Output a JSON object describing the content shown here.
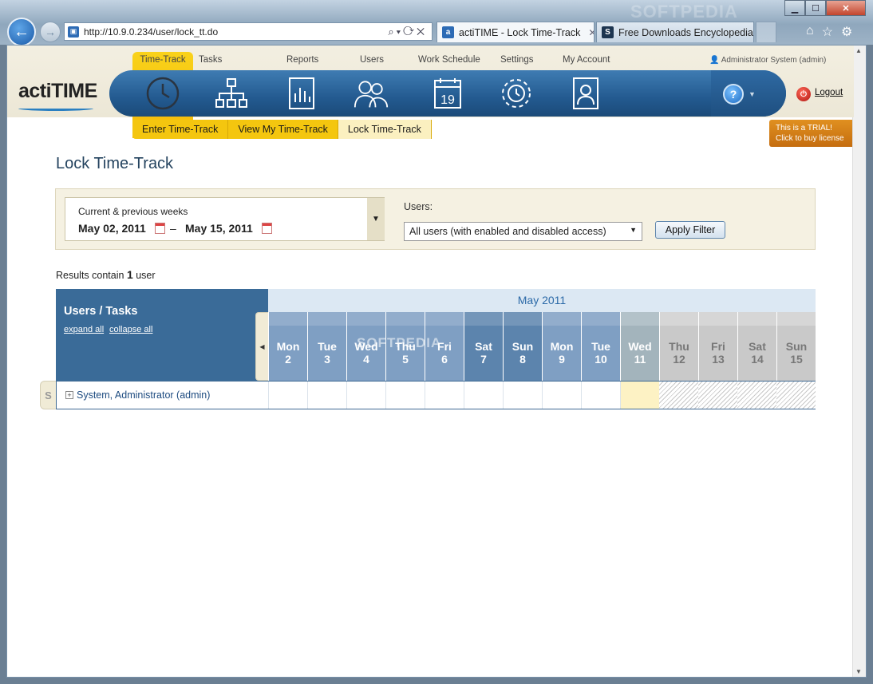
{
  "browser": {
    "watermark": "SOFTPEDIA",
    "url": "http://10.9.0.234/user/lock_tt.do",
    "tabs": [
      {
        "title": "actiTIME - Lock Time-Track",
        "active": true
      },
      {
        "title": "Free Downloads Encyclopedia ...",
        "active": false
      }
    ]
  },
  "app": {
    "logo": "actiTIME",
    "user": "Administrator System (admin)",
    "logout": "Logout",
    "help_icon": "question-mark",
    "trial": {
      "line1": "This is a TRIAL!",
      "line2": "Click to buy license"
    },
    "modules": [
      {
        "label": "Time-Track",
        "icon": "clock",
        "active": true
      },
      {
        "label": "Tasks",
        "icon": "org-chart"
      },
      {
        "label": "Reports",
        "icon": "bar-chart-document"
      },
      {
        "label": "Users",
        "icon": "people"
      },
      {
        "label": "Work Schedule",
        "icon": "calendar-19"
      },
      {
        "label": "Settings",
        "icon": "gear"
      },
      {
        "label": "My Account",
        "icon": "profile-card"
      }
    ],
    "subnav": [
      {
        "label": "Enter Time-Track"
      },
      {
        "label": "View My Time-Track"
      },
      {
        "label": "Lock Time-Track",
        "active": true
      }
    ]
  },
  "page": {
    "title": "Lock Time-Track",
    "filter": {
      "range_label": "Current & previous weeks",
      "from": "May 02, 2011",
      "dash": "–",
      "to": "May 15, 2011",
      "users_label": "Users:",
      "users_value": "All users (with enabled and disabled access)",
      "apply": "Apply Filter"
    },
    "results": {
      "prefix": "Results contain",
      "count": "1",
      "suffix": "user"
    },
    "grid": {
      "header": "Users / Tasks",
      "expand_all": "expand all",
      "collapse_all": "collapse all",
      "month": "May 2011",
      "days": [
        {
          "dow": "Mon",
          "num": "2",
          "state": "open"
        },
        {
          "dow": "Tue",
          "num": "3",
          "state": "open"
        },
        {
          "dow": "Wed",
          "num": "4",
          "state": "open"
        },
        {
          "dow": "Thu",
          "num": "5",
          "state": "open"
        },
        {
          "dow": "Fri",
          "num": "6",
          "state": "open"
        },
        {
          "dow": "Sat",
          "num": "7",
          "state": "weekend"
        },
        {
          "dow": "Sun",
          "num": "8",
          "state": "weekend"
        },
        {
          "dow": "Mon",
          "num": "9",
          "state": "open"
        },
        {
          "dow": "Tue",
          "num": "10",
          "state": "open"
        },
        {
          "dow": "Wed",
          "num": "11",
          "state": "today"
        },
        {
          "dow": "Thu",
          "num": "12",
          "state": "future"
        },
        {
          "dow": "Fri",
          "num": "13",
          "state": "future"
        },
        {
          "dow": "Sat",
          "num": "14",
          "state": "future"
        },
        {
          "dow": "Sun",
          "num": "15",
          "state": "future"
        }
      ],
      "rows": [
        {
          "user": "System, Administrator (admin)",
          "side_tab": "S"
        }
      ]
    },
    "colors": {
      "open": "#7f9fc3",
      "weekend": "#5c84ad",
      "today": "#a3b4bc",
      "future": "#c9c9c9",
      "today_cell": "#fdf2c4"
    }
  }
}
